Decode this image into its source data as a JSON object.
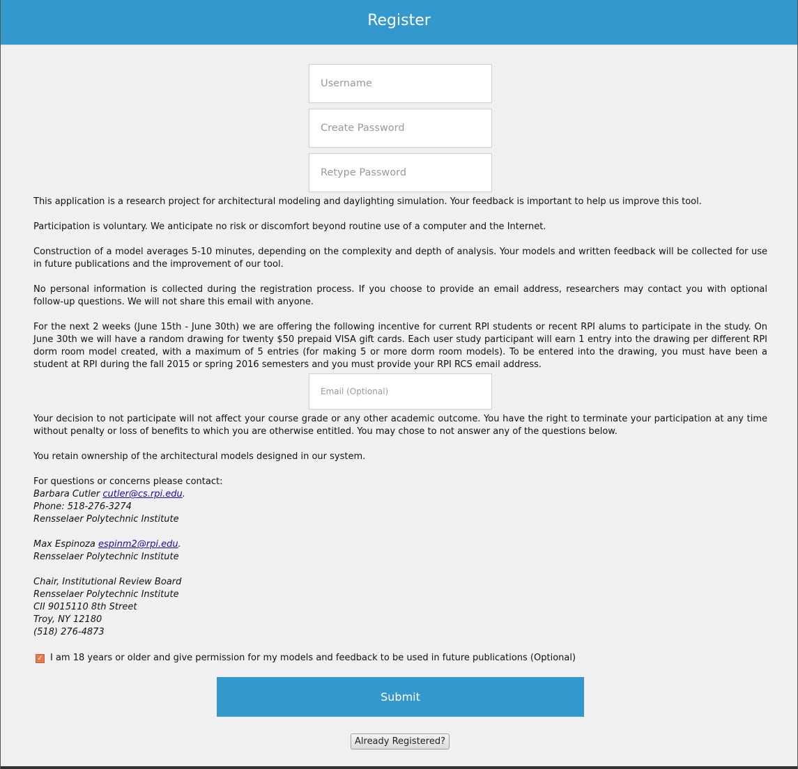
{
  "header": {
    "title": "Register"
  },
  "form": {
    "username_placeholder": "Username",
    "create_password_placeholder": "Create Password",
    "retype_password_placeholder": "Retype Password",
    "email_placeholder": "Email (Optional)"
  },
  "info": {
    "p1": "This application is a research project for architectural modeling and daylighting simulation. Your feedback is important to help us improve this tool.",
    "p2": "Participation is voluntary. We anticipate no risk or discomfort beyond routine use of a computer and the Internet.",
    "p3": "Construction of a model averages 5-10 minutes, depending on the complexity and depth of analysis. Your models and written feedback will be collected for use in future publications and the improvement of our tool.",
    "p4": "No personal information is collected during the registration process. If you choose to provide an email address, researchers may contact you with optional follow-up questions. We will not share this email with anyone.",
    "p5": "For the next 2 weeks (June 15th - June 30th) we are offering the following incentive for current RPI students or recent RPI alums to participate in the study. On June 30th we will have a random drawing for twenty $50 prepaid VISA gift cards. Each user study participant will earn 1 entry into the drawing per different RPI dorm room model created, with a maximum of 5 entries (for making 5 or more dorm room models). To be entered into the drawing, you must have been a student at RPI during the fall 2015 or spring 2016 semesters and you must provide your RPI RCS email address.",
    "p6": "Your decision to not participate will not affect your course grade or any other academic outcome. You have the right to terminate your participation at any time without penalty or loss of benefits to which you are otherwise entitled. You may chose to not answer any of the questions below.",
    "p7": "You retain ownership of the architectural models designed in our system."
  },
  "contact": {
    "intro": "For questions or concerns please contact:",
    "person1_name": "Barbara Cutler ",
    "person1_email": "cutler@cs.rpi.edu",
    "period": ".",
    "person1_phone": "Phone: 518-276-3274",
    "person1_org": "Rensselaer Polytechnic Institute",
    "person2_name": "Max Espinoza ",
    "person2_email": "espinm2@rpi.edu",
    "person2_org": "Rensselaer Polytechnic Institute",
    "board_title": "Chair, Institutional Review Board",
    "board_org": "Rensselaer Polytechnic Institute",
    "board_address": "CII 9015110 8th Street",
    "board_city": "Troy, NY 12180",
    "board_phone": "(518) 276-4873"
  },
  "consent": {
    "checked": true,
    "check_mark": "✓",
    "label": "I am 18 years or older and give permission for my models and feedback to be used in future publications (Optional)"
  },
  "buttons": {
    "submit": "Submit",
    "already_registered": "Already Registered?"
  },
  "colors": {
    "header_bg": "#3399cc",
    "button_bg": "#3399cc",
    "checkbox": "#e8794a",
    "link": "#1a0dab"
  }
}
